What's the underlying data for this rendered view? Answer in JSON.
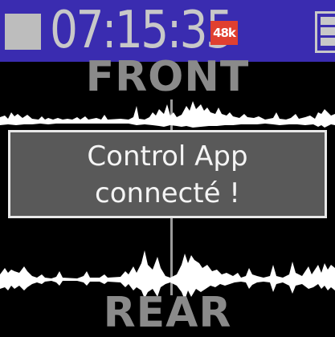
{
  "status_bar": {
    "timer": "07:15:35",
    "sample_rate_badge": "48k",
    "stop_icon": "stop-square-icon",
    "battery_icon": "battery-icon"
  },
  "mic_labels": {
    "front": "FRONT",
    "rear": "REAR"
  },
  "notification": {
    "line1": "Control App",
    "line2": "connecté !"
  },
  "colors": {
    "status_bar_bg": "#3a2cb0",
    "label_gray": "#8a8a8a",
    "badge_red": "#e04030",
    "dialog_bg": "#595959"
  }
}
